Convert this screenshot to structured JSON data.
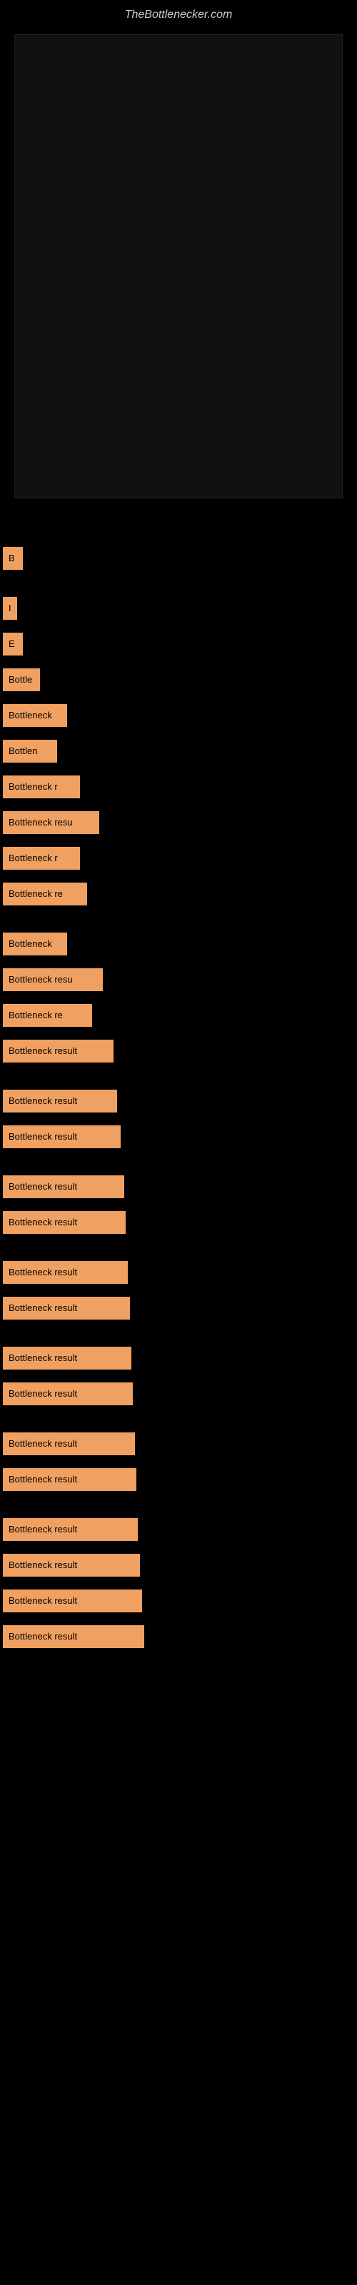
{
  "site": {
    "title": "TheBottlenecker.com"
  },
  "results": [
    {
      "id": 1,
      "label": "B",
      "width": 28
    },
    {
      "id": 2,
      "label": "I",
      "width": 20
    },
    {
      "id": 3,
      "label": "E",
      "width": 28
    },
    {
      "id": 4,
      "label": "Bottle",
      "width": 52
    },
    {
      "id": 5,
      "label": "Bottleneck",
      "width": 90
    },
    {
      "id": 6,
      "label": "Bottlen",
      "width": 76
    },
    {
      "id": 7,
      "label": "Bottleneck r",
      "width": 108
    },
    {
      "id": 8,
      "label": "Bottleneck resu",
      "width": 135
    },
    {
      "id": 9,
      "label": "Bottleneck r",
      "width": 108
    },
    {
      "id": 10,
      "label": "Bottleneck re",
      "width": 118
    },
    {
      "id": 11,
      "label": "Bottleneck",
      "width": 90
    },
    {
      "id": 12,
      "label": "Bottleneck resu",
      "width": 140
    },
    {
      "id": 13,
      "label": "Bottleneck re",
      "width": 125
    },
    {
      "id": 14,
      "label": "Bottleneck result",
      "width": 155
    },
    {
      "id": 15,
      "label": "Bottleneck result",
      "width": 160
    },
    {
      "id": 16,
      "label": "Bottleneck result",
      "width": 165
    },
    {
      "id": 17,
      "label": "Bottleneck result",
      "width": 170
    },
    {
      "id": 18,
      "label": "Bottleneck result",
      "width": 172
    },
    {
      "id": 19,
      "label": "Bottleneck result",
      "width": 175
    },
    {
      "id": 20,
      "label": "Bottleneck result",
      "width": 178
    },
    {
      "id": 21,
      "label": "Bottleneck result",
      "width": 180
    },
    {
      "id": 22,
      "label": "Bottleneck result",
      "width": 182
    },
    {
      "id": 23,
      "label": "Bottleneck result",
      "width": 185
    },
    {
      "id": 24,
      "label": "Bottleneck result",
      "width": 187
    },
    {
      "id": 25,
      "label": "Bottleneck result",
      "width": 189
    },
    {
      "id": 26,
      "label": "Bottleneck result",
      "width": 192
    },
    {
      "id": 27,
      "label": "Bottleneck result",
      "width": 195
    },
    {
      "id": 28,
      "label": "Bottleneck result",
      "width": 198
    }
  ]
}
